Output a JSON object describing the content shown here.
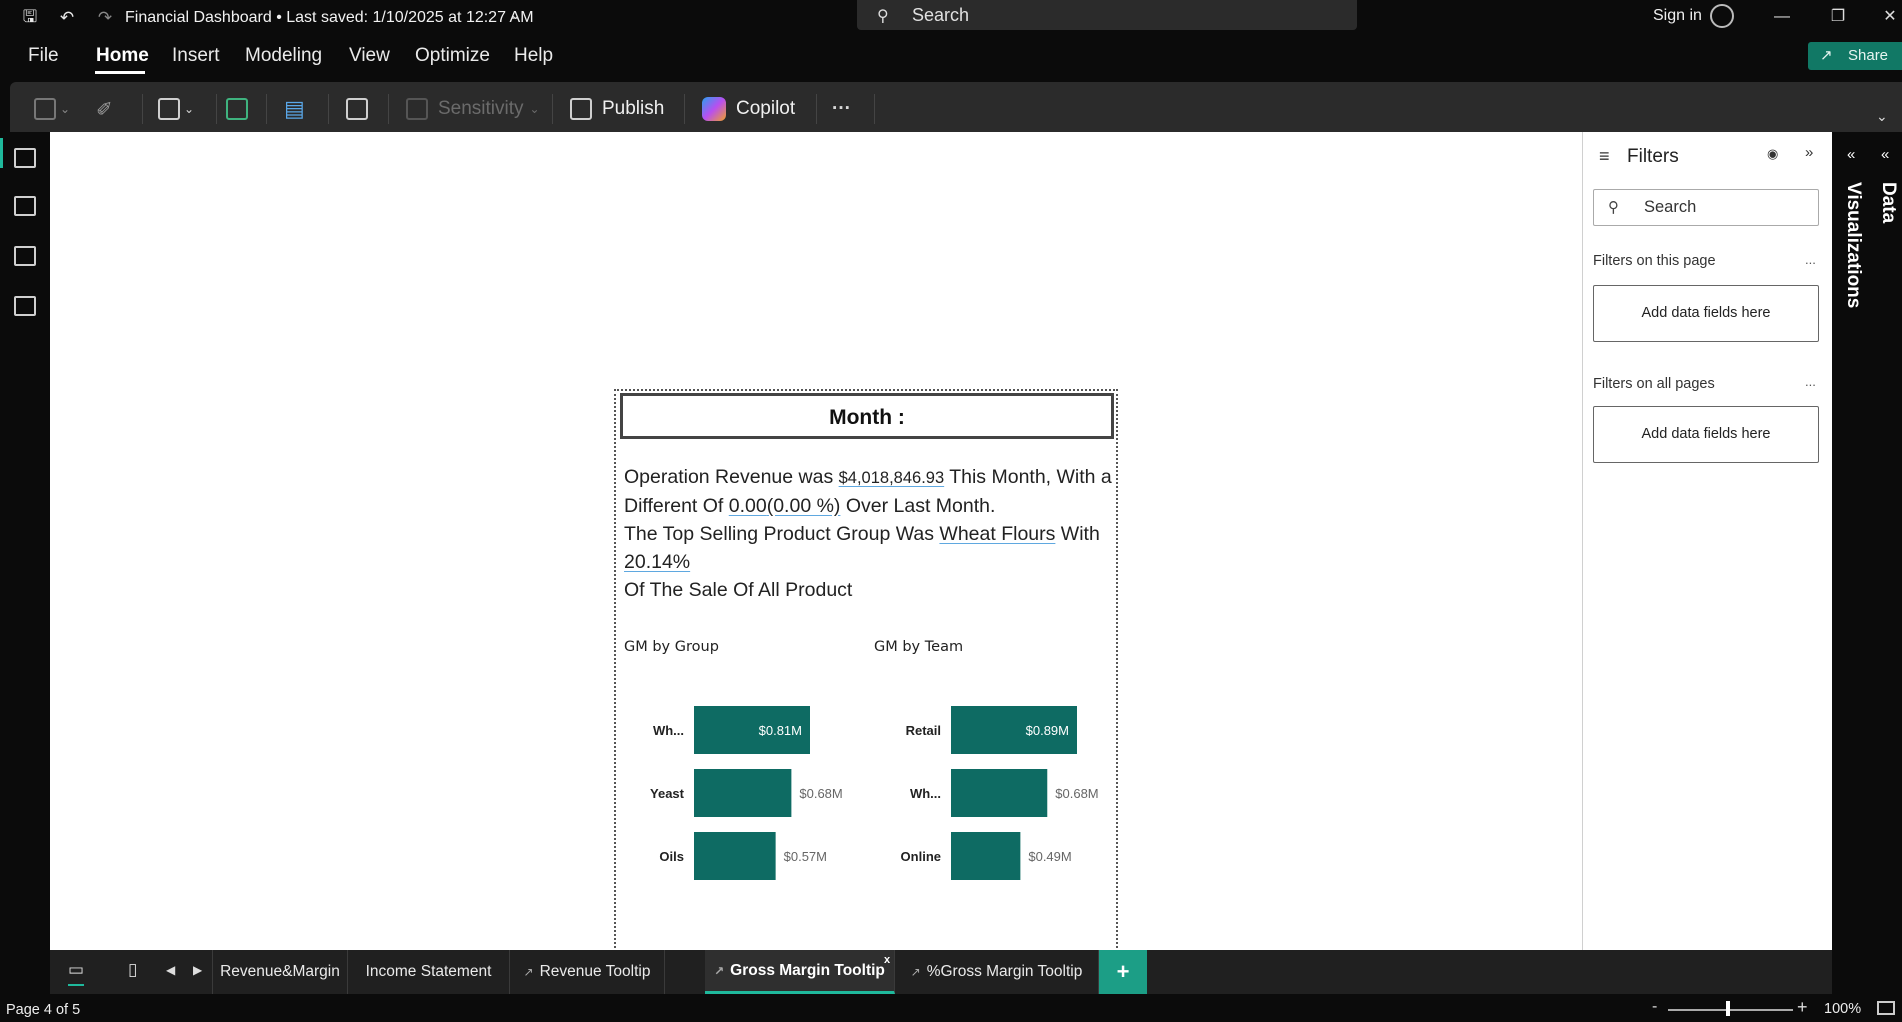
{
  "titlebar": {
    "title": "Financial Dashboard",
    "saved": "Last saved: 1/10/2025 at 12:27 AM",
    "search_placeholder": "Search",
    "signin": "Sign in"
  },
  "menu": {
    "items": [
      "File",
      "Home",
      "Insert",
      "Modeling",
      "View",
      "Optimize",
      "Help"
    ],
    "active": "Home",
    "share": "Share"
  },
  "ribbon": {
    "sensitivity": "Sensitivity",
    "publish": "Publish",
    "copilot": "Copilot",
    "more": "···"
  },
  "tooltip_page": {
    "header": "Month :",
    "summary": {
      "p1_a": "Operation Revenue was ",
      "revenue": "$4,018,846.93",
      "p1_b": " This Month, With a Different Of ",
      "diff_value": "0.00",
      "diff_pct": "(0.00 %)",
      "p1_c": " Over Last Month.",
      "p2_a": "The Top Selling Product Group Was ",
      "top_group": "Wheat Flours",
      "p2_b": " With ",
      "top_pct": "20.14%",
      "p3": "Of The Sale Of All Product"
    }
  },
  "chart_data": [
    {
      "type": "bar",
      "orientation": "horizontal",
      "title": "GM by Group",
      "categories": [
        "Wh...",
        "Yeast",
        "Oils"
      ],
      "values": [
        0.81,
        0.68,
        0.57
      ],
      "labels": [
        "$0.81M",
        "$0.68M",
        "$0.57M"
      ],
      "color": "#0e6b63"
    },
    {
      "type": "bar",
      "orientation": "horizontal",
      "title": "GM by Team",
      "categories": [
        "Retail",
        "Wh...",
        "Online"
      ],
      "values": [
        0.89,
        0.68,
        0.49
      ],
      "labels": [
        "$0.89M",
        "$0.68M",
        "$0.49M"
      ],
      "color": "#0e6b63"
    }
  ],
  "filters": {
    "title": "Filters",
    "search_placeholder": "Search",
    "on_this_page": "Filters on this page",
    "on_all_pages": "Filters on all pages",
    "drop_hint": "Add data fields here",
    "more": "..."
  },
  "panes": {
    "visualizations": "Visualizations",
    "data": "Data"
  },
  "tabs": {
    "items": [
      "Revenue&Margin",
      "Income Statement",
      "Revenue Tooltip",
      "Gross Margin Tooltip",
      "%Gross Margin Tooltip"
    ],
    "active": "Gross Margin Tooltip",
    "close": "x",
    "add": "+"
  },
  "status": {
    "page": "Page 4 of 5",
    "zoom_minus": "-",
    "zoom_plus": "+",
    "zoom": "100%"
  },
  "colors": {
    "accent": "#1fb99c",
    "bar": "#0e6b63",
    "share_bg": "#117865"
  }
}
